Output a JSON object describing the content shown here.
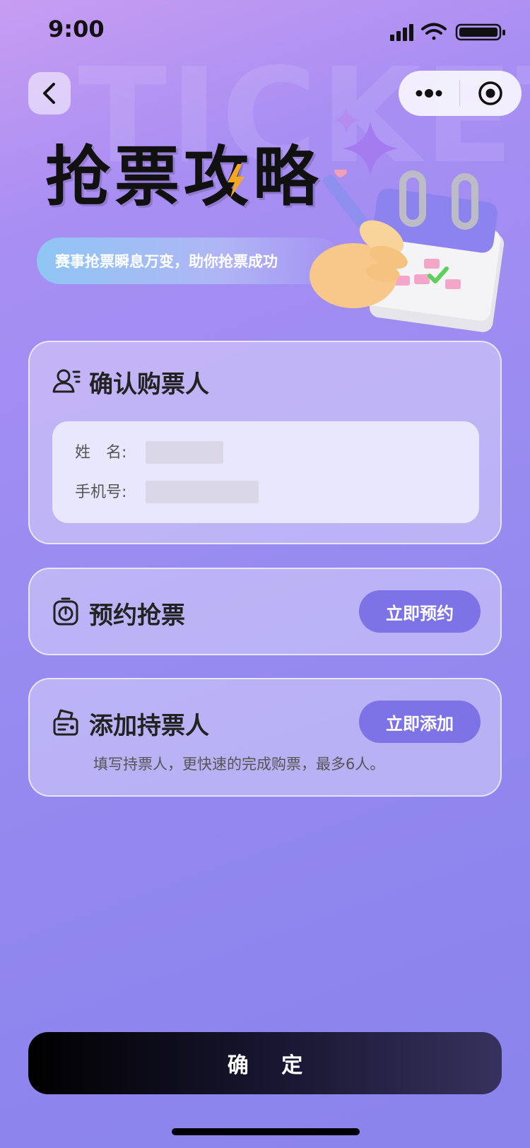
{
  "status": {
    "time": "9:00"
  },
  "watermark": "TICKET",
  "header": {
    "title": "抢票攻略",
    "subtitle": "赛事抢票瞬息万变，助你抢票成功"
  },
  "confirm_buyer": {
    "title": "确认购票人",
    "name_label": "姓　名:",
    "phone_label": "手机号:",
    "name_value": "",
    "phone_value": ""
  },
  "reserve": {
    "title": "预约抢票",
    "button": "立即预约"
  },
  "add_holder": {
    "title": "添加持票人",
    "button": "立即添加",
    "hint": "填写持票人，更快速的完成购票，最多6人。"
  },
  "confirm_button": "确 定",
  "colors": {
    "accent": "#7d73e6",
    "background_top": "#c79df2",
    "background_bottom": "#8a84ec"
  },
  "icons": [
    "back-icon",
    "more-icon",
    "target-icon",
    "user-card-icon",
    "stopwatch-icon",
    "ticket-machine-icon"
  ]
}
